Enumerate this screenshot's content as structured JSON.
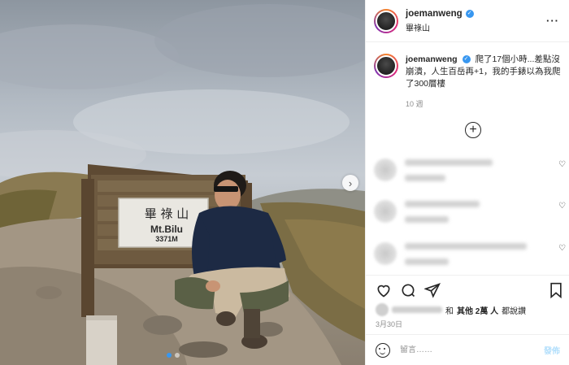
{
  "post": {
    "username": "joemanweng",
    "verified_mark": "✓",
    "location": "畢祿山",
    "more_label": "···"
  },
  "photo": {
    "sign_title": "畢 祿 山",
    "sign_name": "Mt.Bilu",
    "sign_elevation": "3371M",
    "next_icon": "chevron-right-icon",
    "dots": [
      true,
      false
    ]
  },
  "caption": {
    "username": "joemanweng",
    "text": "爬了17個小時...差點沒崩潰，人生百岳再+1，我的手錶以為我爬了300層樓",
    "time": "10 週"
  },
  "load_more_icon": "plus-circle-icon",
  "comments": [
    {
      "blurred": true,
      "heart": "♡"
    },
    {
      "blurred": true,
      "heart": "♡"
    },
    {
      "blurred": true,
      "heart": "♡"
    }
  ],
  "actions": {
    "icons": [
      "heart-icon",
      "comment-icon",
      "share-icon",
      "bookmark-icon"
    ],
    "likes_and": "和",
    "likes_others": "其他 2萬 人",
    "likes_suffix": "都說讚",
    "date": "3月30日"
  },
  "comment_box": {
    "placeholder": "留言……",
    "post_label": "發佈"
  },
  "colors": {
    "accent": "#3897f0",
    "post_disabled": "#b2dffc",
    "muted": "#8e8e8e"
  }
}
